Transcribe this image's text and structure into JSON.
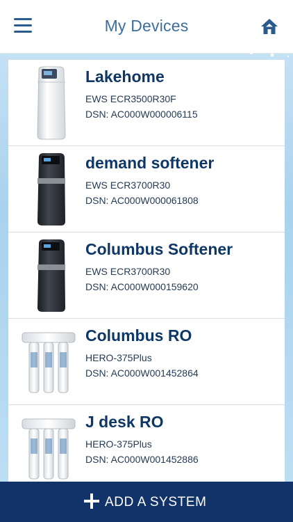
{
  "header": {
    "title": "My Devices",
    "menu_icon": "hamburger-menu-icon",
    "home_icon": "home-icon"
  },
  "devices": [
    {
      "name": "Lakehome",
      "model": "EWS ECR3500R30F",
      "dsn": "DSN: AC000W000006115",
      "image": "white-water-softener"
    },
    {
      "name": "demand softener",
      "model": "EWS ECR3700R30",
      "dsn": "DSN: AC000W000061808",
      "image": "black-water-softener"
    },
    {
      "name": "Columbus Softener",
      "model": "EWS ECR3700R30",
      "dsn": "DSN: AC000W000159620",
      "image": "black-water-softener"
    },
    {
      "name": "Columbus RO",
      "model": "HERO-375Plus",
      "dsn": "DSN: AC000W001452864",
      "image": "reverse-osmosis-filter"
    },
    {
      "name": "J desk RO",
      "model": "HERO-375Plus",
      "dsn": "DSN: AC000W001452886",
      "image": "reverse-osmosis-filter"
    }
  ],
  "footer": {
    "add_label": "ADD A SYSTEM",
    "plus_icon": "plus-icon"
  },
  "colors": {
    "brand_dark": "#12336a",
    "title_blue": "#3d6e9c",
    "device_name": "#0f3766"
  }
}
